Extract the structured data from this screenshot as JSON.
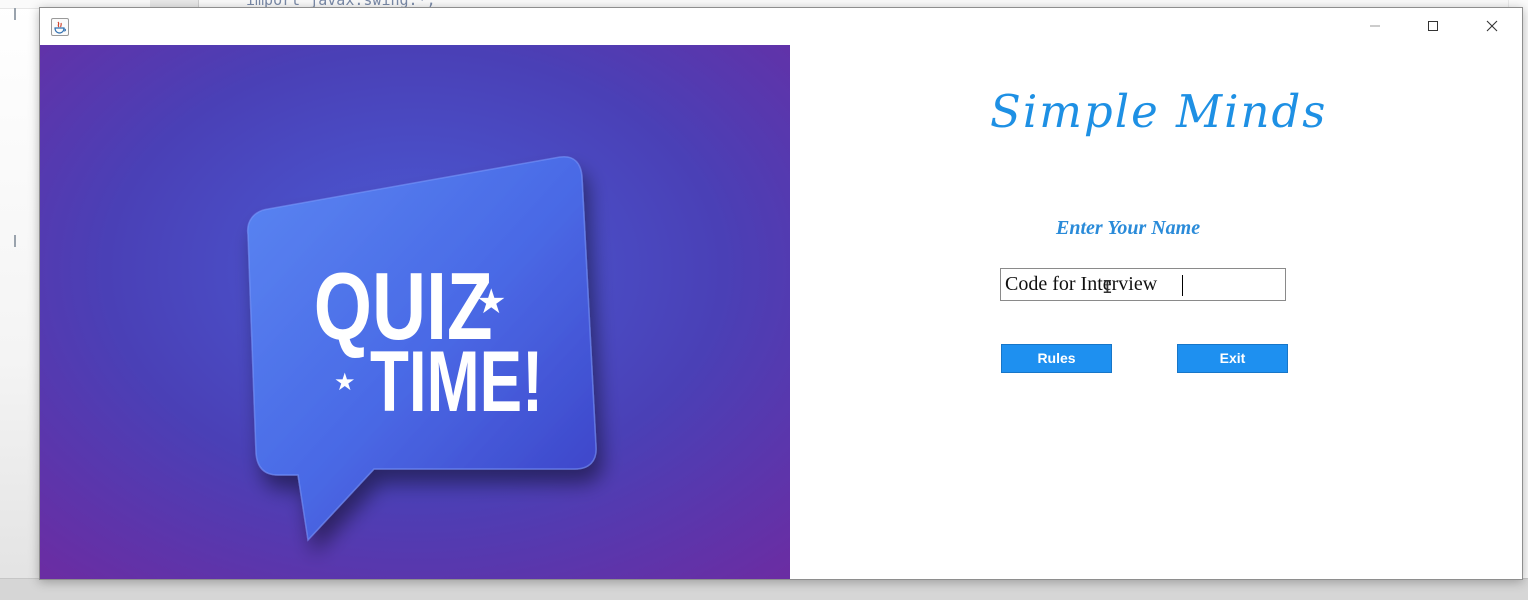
{
  "background_editor": {
    "code_fragment": "import javax.swing.*;"
  },
  "window": {
    "title": "",
    "controls": {
      "minimize": "minimize-icon",
      "maximize": "maximize-icon",
      "close": "close-icon"
    }
  },
  "banner": {
    "line1": "QUIZ",
    "line2": "TIME!",
    "star": "★"
  },
  "app": {
    "heading": "Simple Minds",
    "name_label": "Enter Your Name",
    "name_value": "Code for Interview",
    "rules_button": "Rules",
    "exit_button": "Exit"
  },
  "colors": {
    "accent": "#1e90f0",
    "heading": "#1e90e4",
    "banner_bg": "#4a3fb0"
  }
}
